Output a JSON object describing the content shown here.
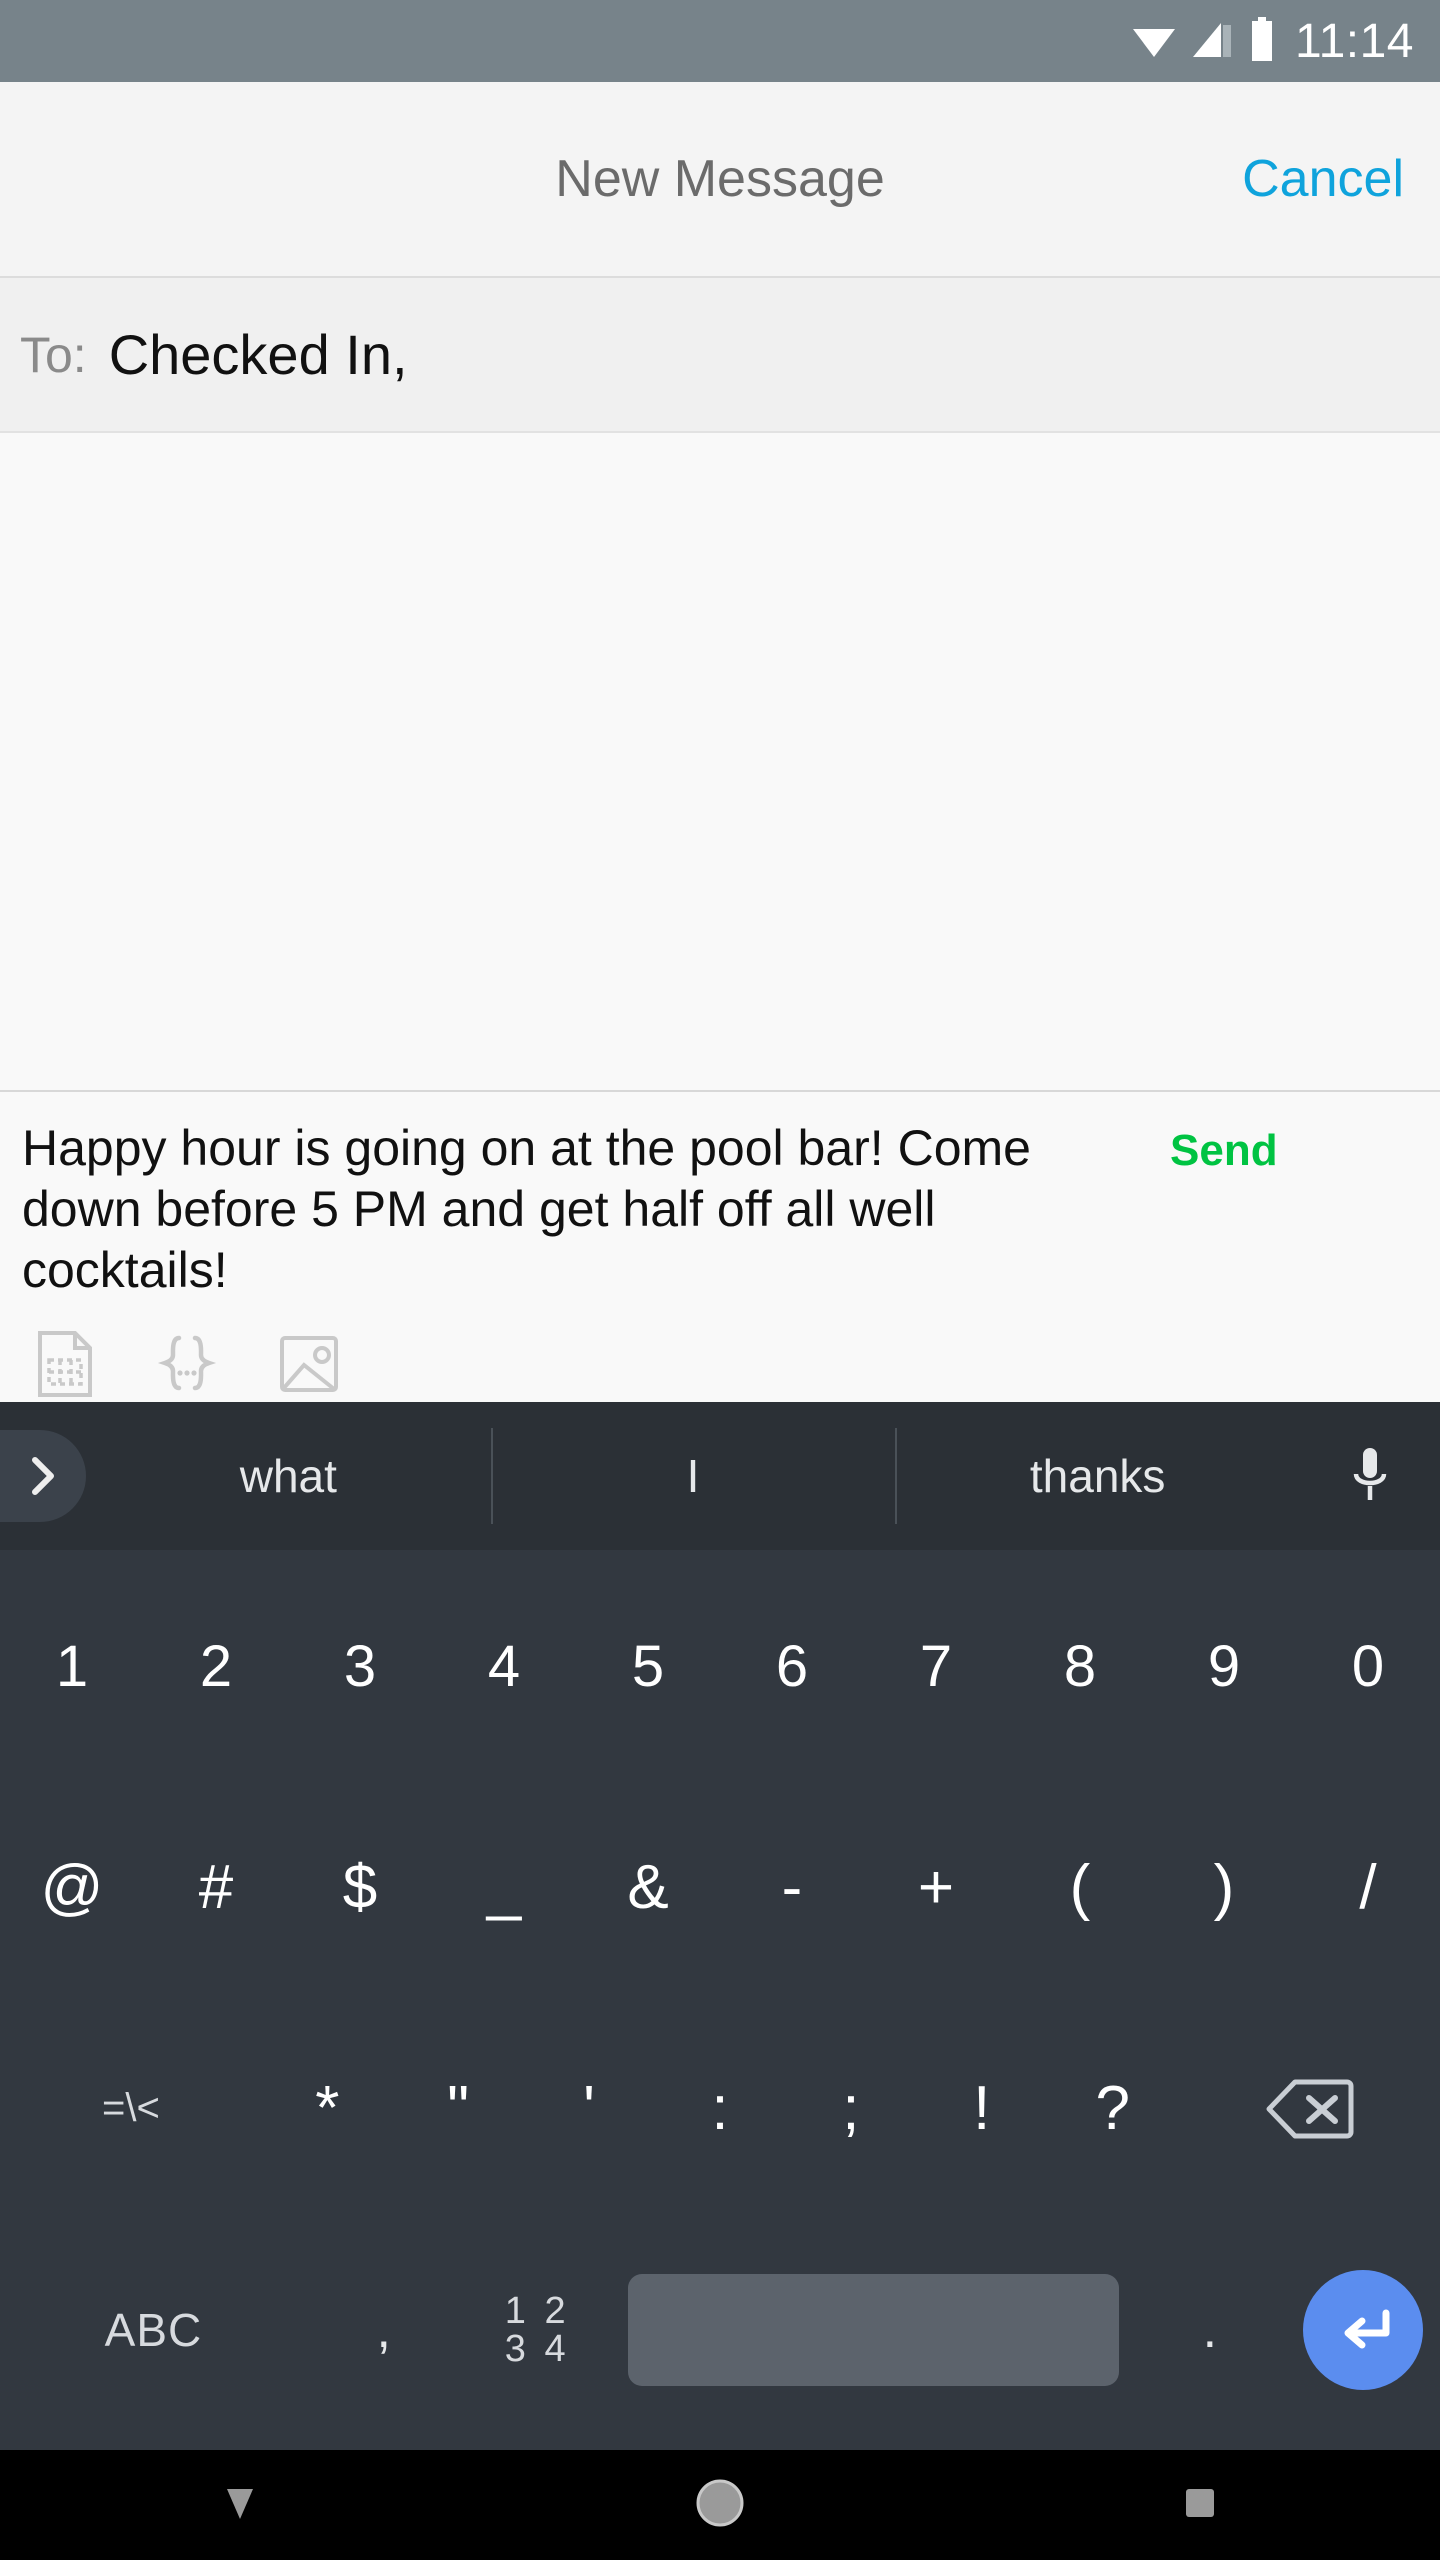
{
  "status_bar": {
    "time": "11:14",
    "icons": [
      "wifi-icon",
      "cellular-signal-icon",
      "battery-icon"
    ],
    "background": "#77838a"
  },
  "title_bar": {
    "title": "New Message",
    "cancel_label": "Cancel",
    "cancel_color": "#0fa3dc"
  },
  "recipient": {
    "label": "To:",
    "value": "Checked In,"
  },
  "compose": {
    "message_text": "Happy hour is going on at the pool bar! Come down before 5 PM and get half off all well cocktails!",
    "send_label": "Send",
    "send_color": "#00c342",
    "attachments": [
      {
        "name": "template-icon"
      },
      {
        "name": "merge-field-icon"
      },
      {
        "name": "image-icon"
      }
    ]
  },
  "keyboard": {
    "suggestions": [
      "what",
      "I",
      "thanks"
    ],
    "expand_icon": "chevron-right-icon",
    "mic_icon": "microphone-icon",
    "row_numbers": [
      "1",
      "2",
      "3",
      "4",
      "5",
      "6",
      "7",
      "8",
      "9",
      "0"
    ],
    "row_symbols": [
      "@",
      "#",
      "$",
      "_",
      "&",
      "-",
      "+",
      "(",
      ")",
      "/"
    ],
    "row_three": {
      "shift_label": "=\\<",
      "keys": [
        "*",
        "\"",
        "'",
        ":",
        ";",
        "!",
        "?"
      ],
      "backspace_icon": "backspace-icon"
    },
    "row_bottom": {
      "abc_label": "ABC",
      "comma": ",",
      "numeric_key": {
        "top": "1 2",
        "bottom": "3 4"
      },
      "space_label": "",
      "period": ".",
      "enter_icon": "enter-icon",
      "enter_color": "#5b8def"
    }
  },
  "nav_bar": {
    "buttons": [
      {
        "name": "hide-keyboard-button",
        "icon": "triangle-down-icon"
      },
      {
        "name": "home-button",
        "icon": "circle-icon"
      },
      {
        "name": "recents-button",
        "icon": "square-icon"
      }
    ]
  }
}
